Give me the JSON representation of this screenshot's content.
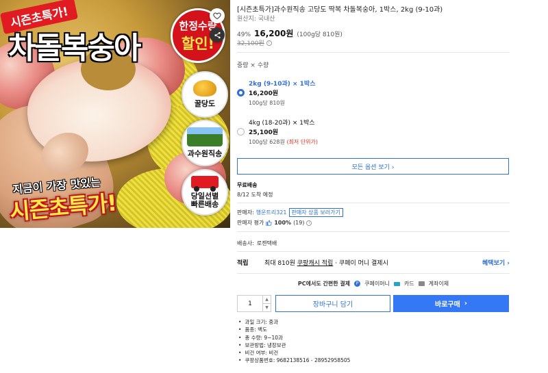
{
  "product": {
    "title": "[시즌초특가]과수원직송 고당도 딱복 차돌복숭아, 1박스, 2kg (9-10과)",
    "origin": "원산지: 국내산",
    "discount": "49%",
    "price": "16,200원",
    "unit_price": "(100g당 810원)",
    "original_price": "32,100원",
    "info_icon": "i"
  },
  "image_text": {
    "ribbon": "시즌초특가!",
    "main_title": "차돌복숭아",
    "limited_line1": "한정수량",
    "limited_line2": "할인!",
    "badge_honey": "꿀당도",
    "badge_orchard": "과수원직송",
    "badge_delivery_line1": "당일선별",
    "badge_delivery_line2": "빠른배송",
    "bottom_line1": "지금이 가장 맛있는",
    "bottom_line2": "시즌초특가!"
  },
  "icons": {
    "heart": "heart-icon",
    "share": "share-icon"
  },
  "options": {
    "header": "중량 × 수량",
    "items": [
      {
        "name": "2kg (9-10과) × 1박스",
        "price": "16,200원",
        "unit": "100g당 810원",
        "note": "",
        "selected": true
      },
      {
        "name": "4kg (18-20과) × 1박스",
        "price": "25,100원",
        "unit": "100g당 628원",
        "note": "(최저 단위가)",
        "selected": false
      }
    ],
    "all_options_button": "모든 옵션 보기 ›"
  },
  "shipping": {
    "label": "무료배송",
    "eta": "8/12 도착 예정"
  },
  "seller": {
    "label": "판매자:",
    "name": "행운트리321",
    "other_button": "판매자 상품 보러가기",
    "rating_label": "판매자 평가",
    "rating_icon": "thumbs-up",
    "rating_value": "100%",
    "rating_count": "(19)"
  },
  "carrier": {
    "label": "배송사:",
    "name": "로젠택배"
  },
  "reward": {
    "label": "적립",
    "text_prefix": "최대 810원",
    "text_link": "쿠팡캐시 적립",
    "text_suffix": "· 쿠페이 머니 결제시",
    "more": "혜택보기 ›"
  },
  "payment": {
    "label": "PC에서도 간편한 결제",
    "methods": [
      "쿠페이머니",
      "카드",
      "계좌이체"
    ]
  },
  "purchase": {
    "quantity": "1",
    "cart_button": "장바구니 담기",
    "buy_button": "바로구매",
    "buy_arrow": "›"
  },
  "specs": [
    "과일 크기: 중과",
    "품종: 백도",
    "총 수량: 9~10과",
    "보관방법: 냉장보관",
    "비건 여부: 비건",
    "쿠팡상품번호: 9682138516 - 28952958505"
  ],
  "colors": {
    "accent": "#2f6fd6",
    "buy_button": "#3478f6",
    "sale_red": "#e0301e"
  }
}
